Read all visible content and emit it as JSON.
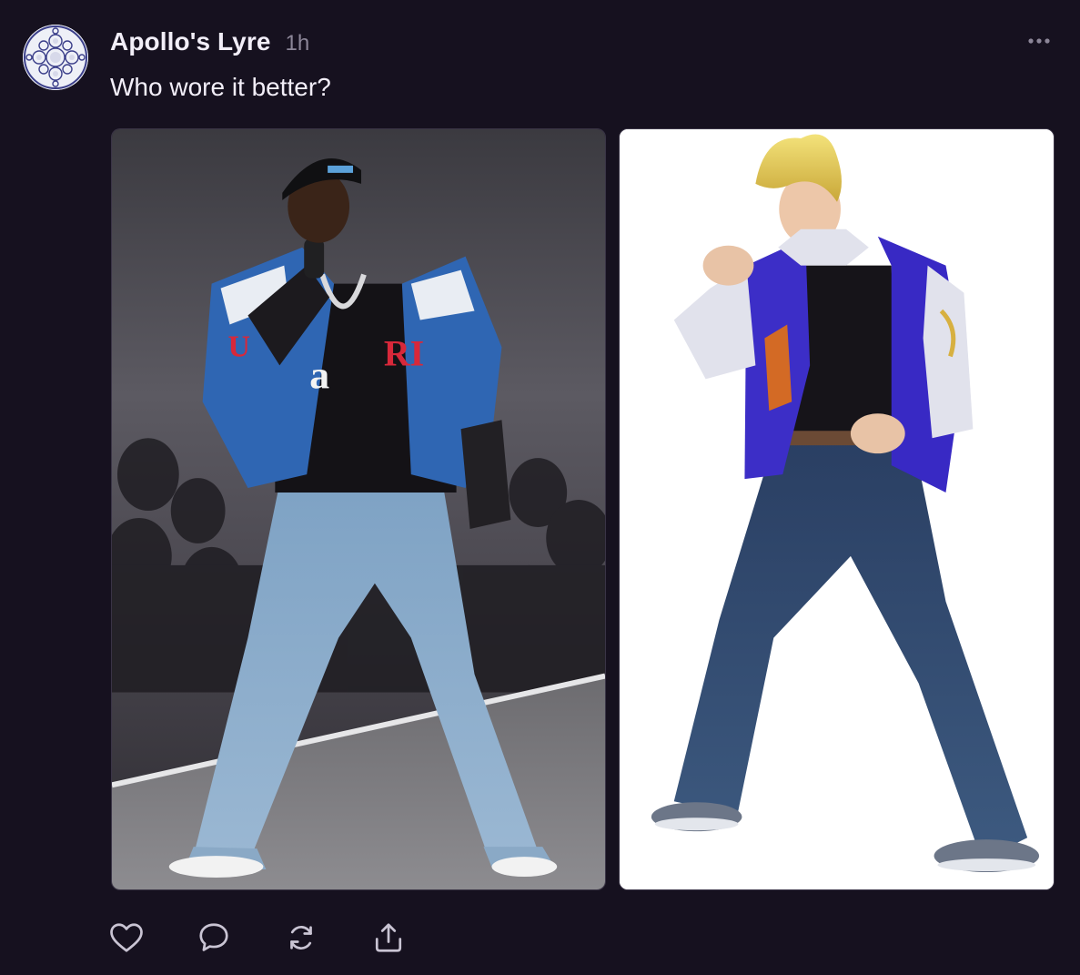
{
  "post": {
    "author": "Apollo's Lyre",
    "timestamp": "1h",
    "text": "Who wore it better?"
  },
  "icons": {
    "avatar": "patterned-circle-avatar",
    "more": "ellipsis-icon",
    "like": "heart-icon",
    "reply": "speech-bubble-icon",
    "repost": "repost-arrows-icon",
    "share": "share-upload-icon"
  },
  "colors": {
    "background": "#16111f",
    "text": "#f2eef8",
    "muted": "#8c8698",
    "icon": "#c9c4d3"
  }
}
